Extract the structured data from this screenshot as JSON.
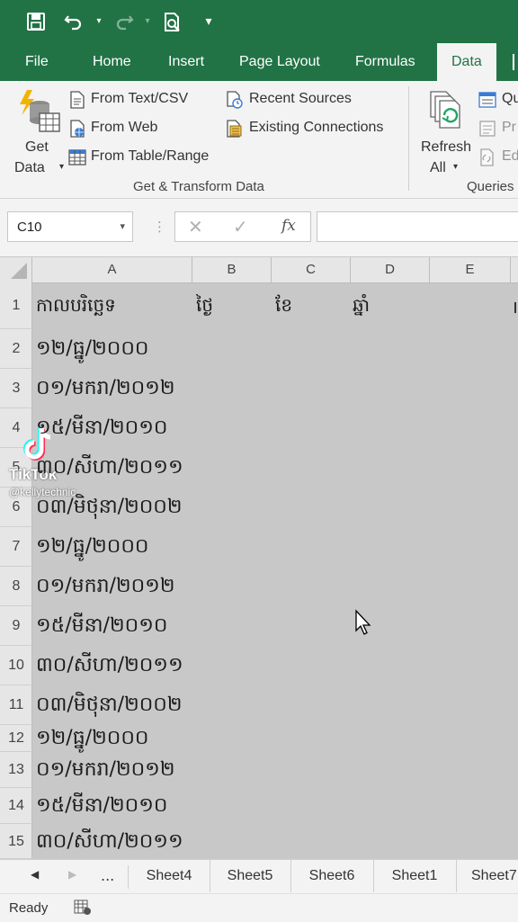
{
  "toolbar": {
    "customize_glyph": "▾"
  },
  "tabs": [
    "File",
    "Home",
    "Insert",
    "Page Layout",
    "Formulas",
    "Data"
  ],
  "ribbon": {
    "get_data": [
      "Get",
      "Data"
    ],
    "from_text_csv": "From Text/CSV",
    "from_web": "From Web",
    "from_table_range": "From Table/Range",
    "recent_sources": "Recent Sources",
    "existing_connections": "Existing Connections",
    "group_label": "Get & Transform Data",
    "refresh_all": [
      "Refresh",
      "All"
    ],
    "queries_partial": "Qu",
    "properties_partial": "Pr",
    "edit_links_partial": "Ed",
    "queries_label": "Queries"
  },
  "formula_bar": {
    "name_box": "C10",
    "value": "",
    "fx": "fx"
  },
  "columns": [
    "A",
    "B",
    "C",
    "D",
    "E"
  ],
  "header_row": {
    "A": "កាលបរិច្ឆេទ",
    "B": "ថ្ងៃ",
    "C": "ខែ",
    "D": "ឆ្នាំ"
  },
  "rows": [
    {
      "num": "1"
    },
    {
      "num": "2",
      "a": "១២/ធ្នូ/២០០០"
    },
    {
      "num": "3",
      "a": "០១/មករា/២០១២"
    },
    {
      "num": "4",
      "a": "១៥/មីនា/២០១០"
    },
    {
      "num": "5",
      "a": "៣០/សីហា/២០១១"
    },
    {
      "num": "6",
      "a": "០៣/មិថុនា/២០០២"
    },
    {
      "num": "7",
      "a": "១២/ធ្នូ/២០០០"
    },
    {
      "num": "8",
      "a": "០១/មករា/២០១២"
    },
    {
      "num": "9",
      "a": "១៥/មីនា/២០១០"
    },
    {
      "num": "10",
      "a": "៣០/សីហា/២០១១"
    },
    {
      "num": "11",
      "a": "០៣/មិថុនា/២០០២"
    },
    {
      "num": "12",
      "a": "១២/ធ្នូ/២០០០"
    },
    {
      "num": "13",
      "a": "០១/មករា/២០១២"
    },
    {
      "num": "14",
      "a": "១៥/មីនា/២០១០"
    },
    {
      "num": "15",
      "a": "៣០/សីហា/២០១១"
    }
  ],
  "sheet_nav": {
    "ellipsis": "..."
  },
  "sheets": [
    "Sheet4",
    "Sheet5",
    "Sheet6",
    "Sheet1",
    "Sheet7"
  ],
  "status": {
    "text": "Ready"
  },
  "watermark": {
    "brand": "TikTok",
    "handle": "@kellytechnic"
  },
  "colors": {
    "excel_green": "#217346",
    "grid_fill": "#c8c8c8",
    "ribbon": "#f3f3f3"
  }
}
